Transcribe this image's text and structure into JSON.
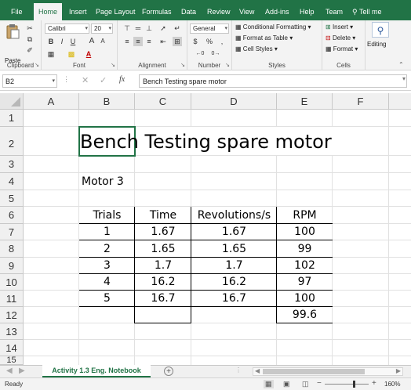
{
  "ribbon_tabs": [
    "File",
    "Home",
    "Insert",
    "Page Layout",
    "Formulas",
    "Data",
    "Review",
    "View",
    "Add-ins",
    "Help",
    "Team"
  ],
  "tell_me": "Tell me",
  "clipboard": {
    "paste": "Paste",
    "label": "Clipboard"
  },
  "font": {
    "name": "Calibri",
    "size": "20",
    "label": "Font",
    "bold": "B",
    "italic": "I",
    "underline": "U",
    "grow": "A",
    "shrink": "A",
    "font_color": "A"
  },
  "alignment": {
    "label": "Alignment"
  },
  "number": {
    "format": "General",
    "percent": "%",
    "comma": ",",
    "label": "Number"
  },
  "styles": {
    "conditional": "Conditional Formatting",
    "format_table": "Format as Table",
    "cell_styles": "Cell Styles",
    "label": "Styles"
  },
  "cells": {
    "insert": "Insert",
    "delete": "Delete",
    "format": "Format",
    "label": "Cells"
  },
  "editing": {
    "label": "Editing"
  },
  "formula_bar": {
    "name_box": "B2",
    "fx": "fx",
    "formula": "Bench Testing spare motor"
  },
  "columns": [
    "A",
    "B",
    "C",
    "D",
    "E",
    "F"
  ],
  "rows": [
    "1",
    "2",
    "3",
    "4",
    "5",
    "6",
    "7",
    "8",
    "9",
    "10",
    "11",
    "12",
    "13",
    "14",
    "15"
  ],
  "sheet": {
    "title": "Bench Testing spare motor",
    "subtitle": "Motor 3",
    "headers": [
      "Trials",
      "Time",
      "Revolutions/s",
      "RPM"
    ],
    "table": [
      [
        "1",
        "1.67",
        "1.67",
        "100"
      ],
      [
        "2",
        "1.65",
        "1.65",
        "99"
      ],
      [
        "3",
        "1.7",
        "1.7",
        "102"
      ],
      [
        "4",
        "16.2",
        "16.2",
        "97"
      ],
      [
        "5",
        "16.7",
        "16.7",
        "100"
      ]
    ],
    "average": "99.6"
  },
  "sheet_tab": "Activity 1.3 Eng. Notebook",
  "status": {
    "ready": "Ready",
    "zoom": "160%"
  },
  "colors": {
    "accent": "#217346"
  }
}
